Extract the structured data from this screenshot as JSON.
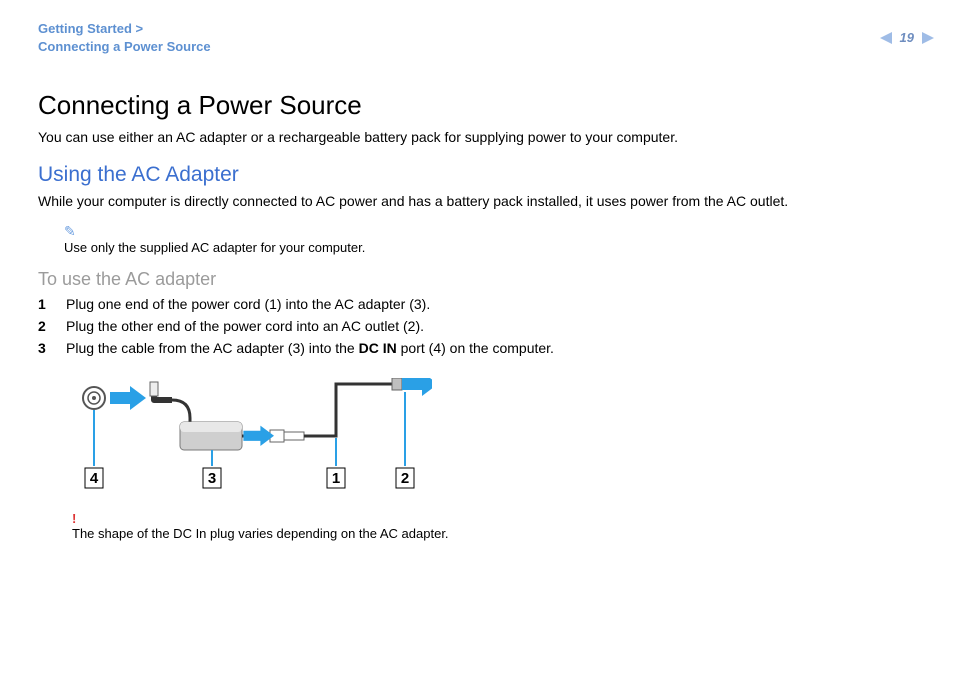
{
  "breadcrumb": {
    "line1": "Getting Started",
    "line2": "Connecting a Power Source"
  },
  "page_number": "19",
  "title": "Connecting a Power Source",
  "intro": "You can use either an AC adapter or a rechargeable battery pack for supplying power to your computer.",
  "h2": "Using the AC Adapter",
  "para1": "While your computer is directly connected to AC power and has a battery pack installed, it uses power from the AC outlet.",
  "note1": "Use only the supplied AC adapter for your computer.",
  "h3": "To use the AC adapter",
  "steps": [
    {
      "n": "1",
      "t": "Plug one end of the power cord (1) into the AC adapter (3)."
    },
    {
      "n": "2",
      "t": "Plug the other end of the power cord into an AC outlet (2)."
    },
    {
      "n": "3",
      "pre": "Plug the cable from the AC adapter (3) into the ",
      "bold": "DC IN",
      "post": " port (4) on the computer."
    }
  ],
  "labels": {
    "l1": "1",
    "l2": "2",
    "l3": "3",
    "l4": "4"
  },
  "caution": "The shape of the DC In plug varies depending on the AC adapter."
}
